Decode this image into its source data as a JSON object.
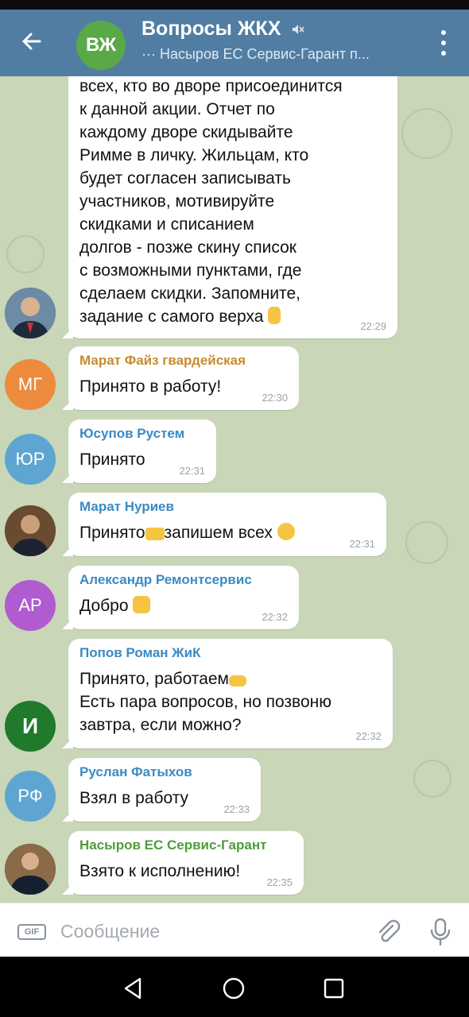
{
  "header": {
    "back_icon": "arrow-left-icon",
    "avatar_initials": "ВЖ",
    "title": "Вопросы ЖКХ",
    "subtitle": "··· Насыров ЕС Сервис-Гарант п...",
    "menu_icon": "more-vertical-icon"
  },
  "messages": [
    {
      "sender": "",
      "text_lines": [
        "всех, кто во дворе присоединится",
        "к данной акции. Отчет по",
        "каждому дворе скидывайте",
        "Римме в личку. Жильцам, кто",
        "будет согласен записывать",
        "участников, мотивируйте",
        "скидками и списанием",
        "долгов - позже скину список",
        "с возможными пунктами, где",
        "сделаем скидки. Запомните,",
        "задание с самого верха"
      ],
      "emoji": "pointing-up",
      "time": "22:29"
    },
    {
      "sender": "Марат Файз гвардейская",
      "text": "Принято в работу!",
      "time": "22:30",
      "initials": "МГ"
    },
    {
      "sender": "Юсупов Рустем",
      "text": "Принято",
      "time": "22:31",
      "initials": "ЮР"
    },
    {
      "sender": "Марат Нуриев",
      "text_a": "Принято",
      "text_b": "запишем всех",
      "time": "22:31"
    },
    {
      "sender": "Александр Ремонтсервис",
      "text": "Добро",
      "time": "22:32",
      "initials": "АР"
    },
    {
      "sender": "Попов Роман ЖиК",
      "line1": "Принято, работаем",
      "line2": "Есть пара вопросов, но позвоню",
      "line3": "завтра, если можно?",
      "time": "22:32",
      "avatar_letter": "И"
    },
    {
      "sender": "Руслан Фатыхов",
      "text": "Взял в работу",
      "time": "22:33",
      "initials": "РФ"
    },
    {
      "sender": "Насыров ЕС Сервис-Гарант",
      "text": "Взято к исполнению!",
      "time": "22:35"
    }
  ],
  "composer": {
    "gif_label": "GIF",
    "placeholder": "Сообщение",
    "attach_icon": "paperclip-icon",
    "mic_icon": "microphone-icon"
  },
  "navbar": {
    "back": "triangle-back-icon",
    "home": "circle-home-icon",
    "recents": "square-recents-icon"
  },
  "colors": {
    "header": "#517da2",
    "sender": "#3a8bc2",
    "chat_bg": "#c9d6b8"
  }
}
